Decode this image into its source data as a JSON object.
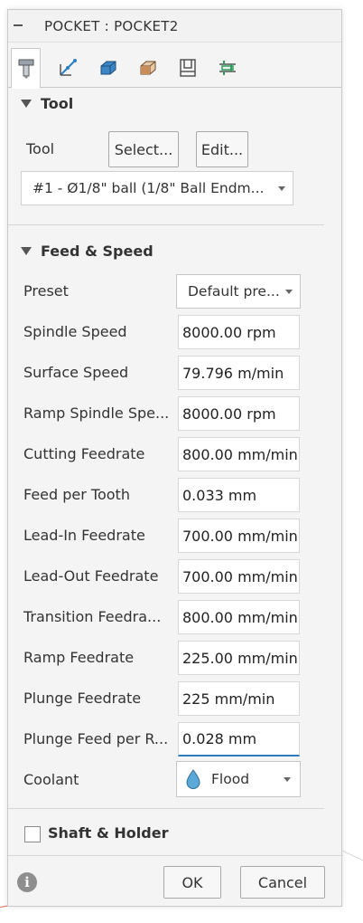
{
  "dialog": {
    "title": "POCKET : POCKET2",
    "tabs": [
      {
        "icon": "tool-tab-icon"
      },
      {
        "icon": "geometry-tab-icon"
      },
      {
        "icon": "heights-tab-icon"
      },
      {
        "icon": "passes-tab-icon"
      },
      {
        "icon": "linking-tab-icon"
      },
      {
        "icon": "multiaxis-tab-icon"
      }
    ]
  },
  "tool_section": {
    "header": "Tool",
    "tool_label": "Tool",
    "select_button": "Select...",
    "edit_button": "Edit...",
    "tool_dropdown": "#1 - Ø1/8\" ball (1/8\" Ball Endm..."
  },
  "feed_section": {
    "header": "Feed & Speed",
    "preset_label": "Preset",
    "preset_value": "Default pre...",
    "fields": [
      {
        "label": "Spindle Speed",
        "value": "8000.00 rpm"
      },
      {
        "label": "Surface Speed",
        "value": "79.796 m/min"
      },
      {
        "label": "Ramp Spindle Spe...",
        "value": "8000.00 rpm"
      },
      {
        "label": "Cutting Feedrate",
        "value": "800.00 mm/min"
      },
      {
        "label": "Feed per Tooth",
        "value": "0.033 mm"
      },
      {
        "label": "Lead-In Feedrate",
        "value": "700.00 mm/min"
      },
      {
        "label": "Lead-Out Feedrate",
        "value": "700.00 mm/min"
      },
      {
        "label": "Transition Feedra...",
        "value": "800.00 mm/min"
      },
      {
        "label": "Ramp Feedrate",
        "value": "225.00 mm/min"
      },
      {
        "label": "Plunge Feedrate",
        "value": "225 mm/min"
      },
      {
        "label": "Plunge Feed per R...",
        "value": "0.028 mm"
      }
    ],
    "coolant_label": "Coolant",
    "coolant_value": "Flood"
  },
  "shaft_section": {
    "label": "Shaft & Holder",
    "checked": false
  },
  "footer": {
    "ok": "OK",
    "cancel": "Cancel"
  },
  "colors": {
    "accent": "#2f7bbf",
    "coolant_drop": "#5aa9d6"
  }
}
